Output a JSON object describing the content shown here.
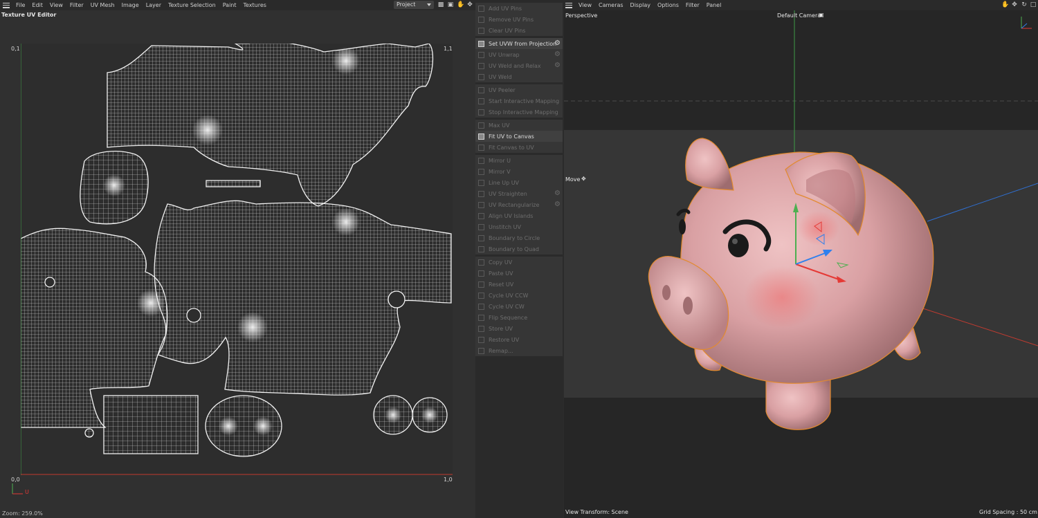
{
  "uv_editor": {
    "menu": [
      "File",
      "Edit",
      "View",
      "Filter",
      "UV Mesh",
      "Image",
      "Layer",
      "Texture Selection",
      "Paint",
      "Textures"
    ],
    "project_select": "Project",
    "title": "Texture UV Editor",
    "corners": {
      "top_left": "0,1",
      "top_right": "1,1",
      "bottom_left": "0,0",
      "bottom_right": "1,0"
    },
    "axis_label": "U",
    "zoom": "Zoom: 259.0%"
  },
  "commands": [
    [
      {
        "label": "Add UV Pins",
        "enabled": false,
        "gear": false
      },
      {
        "label": "Remove UV Pins",
        "enabled": false,
        "gear": false
      },
      {
        "label": "Clear UV Pins",
        "enabled": false,
        "gear": false
      }
    ],
    [
      {
        "label": "Set UVW from Projection",
        "enabled": true,
        "gear": true
      },
      {
        "label": "UV Unwrap",
        "enabled": false,
        "gear": true
      },
      {
        "label": "UV Weld and Relax",
        "enabled": false,
        "gear": true
      },
      {
        "label": "UV Weld",
        "enabled": false,
        "gear": false
      }
    ],
    [
      {
        "label": "UV Peeler",
        "enabled": false,
        "gear": false
      },
      {
        "label": "Start Interactive Mapping",
        "enabled": false,
        "gear": false
      },
      {
        "label": "Stop Interactive Mapping",
        "enabled": false,
        "gear": false
      }
    ],
    [
      {
        "label": "Max UV",
        "enabled": false,
        "gear": false
      },
      {
        "label": "Fit UV to Canvas",
        "enabled": true,
        "gear": false
      },
      {
        "label": "Fit Canvas to UV",
        "enabled": false,
        "gear": false
      }
    ],
    [
      {
        "label": "Mirror U",
        "enabled": false,
        "gear": false
      },
      {
        "label": "Mirror V",
        "enabled": false,
        "gear": false
      },
      {
        "label": "Line Up UV",
        "enabled": false,
        "gear": false
      },
      {
        "label": "UV Straighten",
        "enabled": false,
        "gear": true
      },
      {
        "label": "UV Rectangularize",
        "enabled": false,
        "gear": true
      },
      {
        "label": "Align UV Islands",
        "enabled": false,
        "gear": false
      },
      {
        "label": "Unstitch UV",
        "enabled": false,
        "gear": false
      },
      {
        "label": "Boundary to Circle",
        "enabled": false,
        "gear": false
      },
      {
        "label": "Boundary to Quad",
        "enabled": false,
        "gear": false
      }
    ],
    [
      {
        "label": "Copy UV",
        "enabled": false,
        "gear": false
      },
      {
        "label": "Paste UV",
        "enabled": false,
        "gear": false
      },
      {
        "label": "Reset UV",
        "enabled": false,
        "gear": false
      },
      {
        "label": "Cycle UV CCW",
        "enabled": false,
        "gear": false
      },
      {
        "label": "Cycle UV CW",
        "enabled": false,
        "gear": false
      },
      {
        "label": "Flip Sequence",
        "enabled": false,
        "gear": false
      },
      {
        "label": "Store UV",
        "enabled": false,
        "gear": false
      },
      {
        "label": "Restore UV",
        "enabled": false,
        "gear": false
      },
      {
        "label": "Remap...",
        "enabled": false,
        "gear": false
      }
    ]
  ],
  "viewport": {
    "menu": [
      "View",
      "Cameras",
      "Display",
      "Options",
      "Filter",
      "Panel"
    ],
    "projection": "Perspective",
    "camera": "Default Camera",
    "tool": "Move",
    "view_transform": "View Transform: Scene",
    "grid_spacing": "Grid Spacing : 50 cm"
  },
  "colors": {
    "piggy": "#d9a0a3",
    "outline": "#e38a2e",
    "axis_x": "#e53935",
    "axis_y": "#43a047",
    "axis_z": "#1e88e5"
  }
}
